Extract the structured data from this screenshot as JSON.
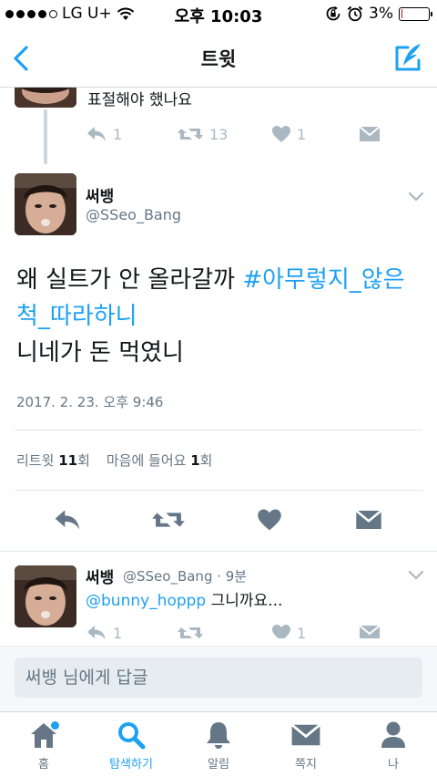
{
  "status_bar": {
    "carrier": "LG U+",
    "time": "오후 10:03",
    "battery": "3%",
    "battery_level": 0.03,
    "battery_color": "#d0021b"
  },
  "nav": {
    "title": "트윗",
    "accent_color": "#1da1f2"
  },
  "parent_tweet": {
    "text": "표절해야 했나요",
    "reply_count": "1",
    "retweet_count": "13",
    "like_count": "1"
  },
  "main_tweet": {
    "name": "써뱅",
    "handle": "@SSeo_Bang",
    "text_before": "왜 실트가 안 올라갈까 ",
    "hashtag": "#아무렇지_않은척_따라하니",
    "text_after": "니네가 돈 먹였니",
    "timestamp": "2017. 2. 23. 오후 9:46",
    "retweet_label": "리트윗",
    "retweet_value": "11",
    "retweet_unit": "회",
    "like_label": "마음에 들어요",
    "like_value": "1",
    "like_unit": "회"
  },
  "reply_tweet": {
    "name": "써뱅",
    "handle_time": "@SSeo_Bang · 9분",
    "mention": "@bunny_hoppp",
    "text": " 그니까요...",
    "reply_count": "1",
    "like_count": "1"
  },
  "composer": {
    "placeholder": "써뱅 님에게 답글"
  },
  "tabbar": {
    "tabs": [
      {
        "label": "홈",
        "icon": "home-icon"
      },
      {
        "label": "탐색하기",
        "icon": "search-icon"
      },
      {
        "label": "알림",
        "icon": "bell-icon"
      },
      {
        "label": "쪽지",
        "icon": "envelope-icon"
      },
      {
        "label": "나",
        "icon": "person-icon"
      }
    ],
    "active_tab": "탐색하기"
  }
}
